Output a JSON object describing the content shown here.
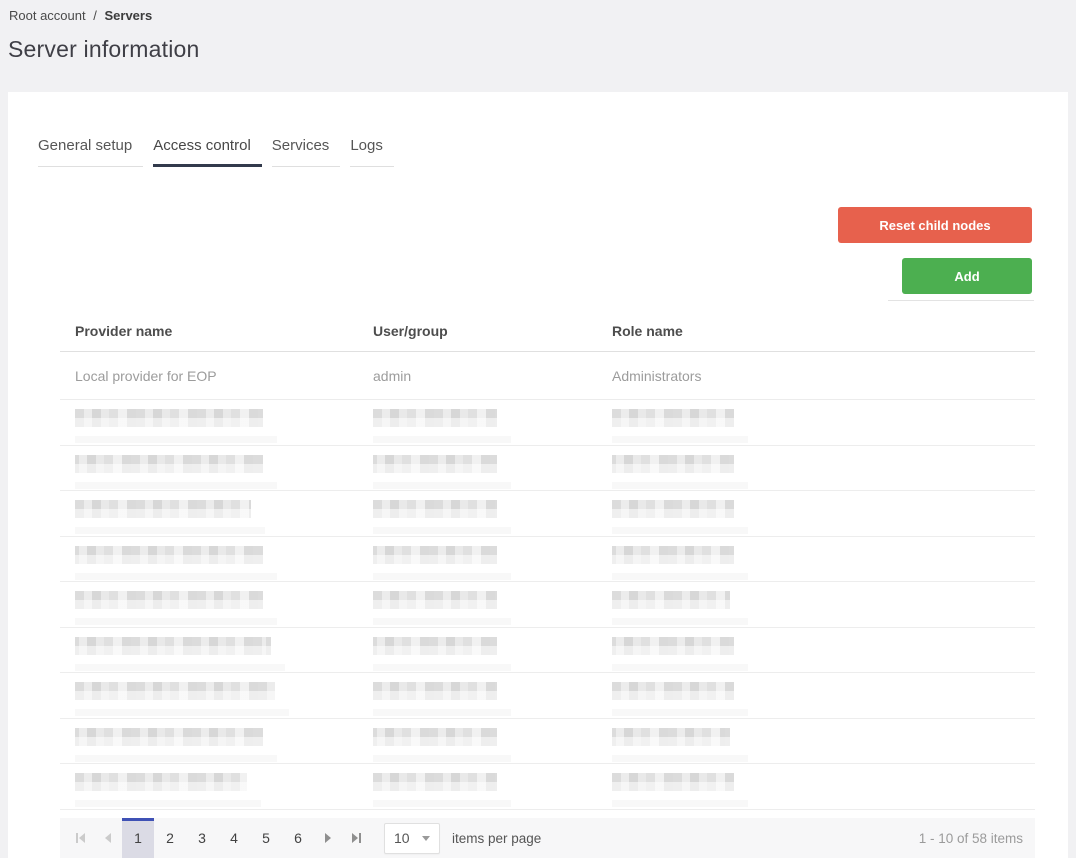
{
  "breadcrumb": {
    "root_label": "Root account",
    "separator": "/",
    "current": "Servers"
  },
  "page_title": "Server information",
  "tabs": [
    {
      "label": "General setup",
      "active": false
    },
    {
      "label": "Access control",
      "active": true
    },
    {
      "label": "Services",
      "active": false
    },
    {
      "label": "Logs",
      "active": false
    }
  ],
  "buttons": {
    "reset_label": "Reset child nodes",
    "add_label": "Add"
  },
  "table": {
    "columns": [
      "Provider name",
      "User/group",
      "Role name"
    ],
    "rows": [
      {
        "provider": "Local provider for EOP",
        "user": "admin",
        "role": "Administrators"
      }
    ],
    "redacted_row_count": 9
  },
  "pagination": {
    "pages": [
      "1",
      "2",
      "3",
      "4",
      "5",
      "6"
    ],
    "current_page": "1",
    "page_size": "10",
    "items_per_page_label": "items per page",
    "range_label": "1 - 10 of 58 items",
    "icons": {
      "first": "first-page-icon",
      "previous": "previous-page-icon",
      "next": "next-page-icon",
      "last": "last-page-icon",
      "page_size": "chevron-down-icon"
    }
  },
  "colors": {
    "reset_button": "#e7614d",
    "add_button": "#4caf50",
    "active_tab_underline": "#323a4c",
    "selected_page_top_border": "#3f51b5",
    "selected_page_bg": "#dbdbe5",
    "page_background": "#f1f1f3"
  }
}
